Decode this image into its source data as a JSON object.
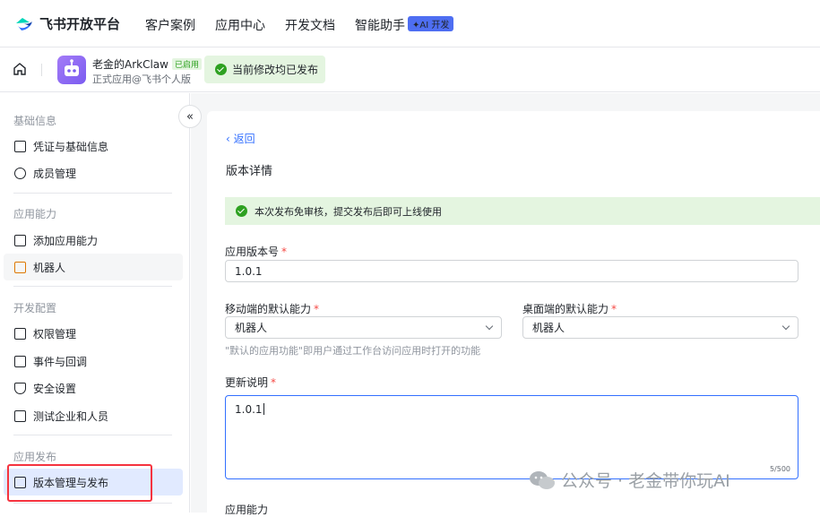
{
  "topbar": {
    "brand": "飞书开放平台",
    "nav": [
      "客户案例",
      "应用中心",
      "开发文档",
      "智能助手"
    ],
    "ai_badge": "✦AI 开发"
  },
  "appbar": {
    "app_name": "老金的ArkClaw",
    "enabled_badge": "已启用",
    "app_sub": "正式应用@飞书个人版",
    "publish_status": "当前修改均已发布"
  },
  "sidebar": {
    "sections": [
      {
        "title": "基础信息",
        "items": [
          "凭证与基础信息",
          "成员管理"
        ]
      },
      {
        "title": "应用能力",
        "items": [
          "添加应用能力",
          "机器人"
        ]
      },
      {
        "title": "开发配置",
        "items": [
          "权限管理",
          "事件与回调",
          "安全设置",
          "测试企业和人员"
        ]
      },
      {
        "title": "应用发布",
        "items": [
          "版本管理与发布"
        ]
      }
    ],
    "collapse_icon": "«"
  },
  "main": {
    "back_label": "返回",
    "title": "版本详情",
    "notice": "本次发布免审核，提交发布后即可上线使用",
    "version_label": "应用版本号",
    "version_value": "1.0.1",
    "mobile_label": "移动端的默认能力",
    "mobile_value": "机器人",
    "desktop_label": "桌面端的默认能力",
    "desktop_value": "机器人",
    "hint": "\"默认的应用功能\"即用户通过工作台访问应用时打开的功能",
    "notes_label": "更新说明",
    "notes_value": "1.0.1",
    "counter": "5/500",
    "next_section": "应用能力",
    "required_mark": "*"
  },
  "watermark": "公众号 · 老金带你玩AI",
  "colors": {
    "accent": "#3370ff",
    "success": "#2ea121",
    "active_bg": "#e1eaff",
    "highlight_box": "#f5333f"
  }
}
